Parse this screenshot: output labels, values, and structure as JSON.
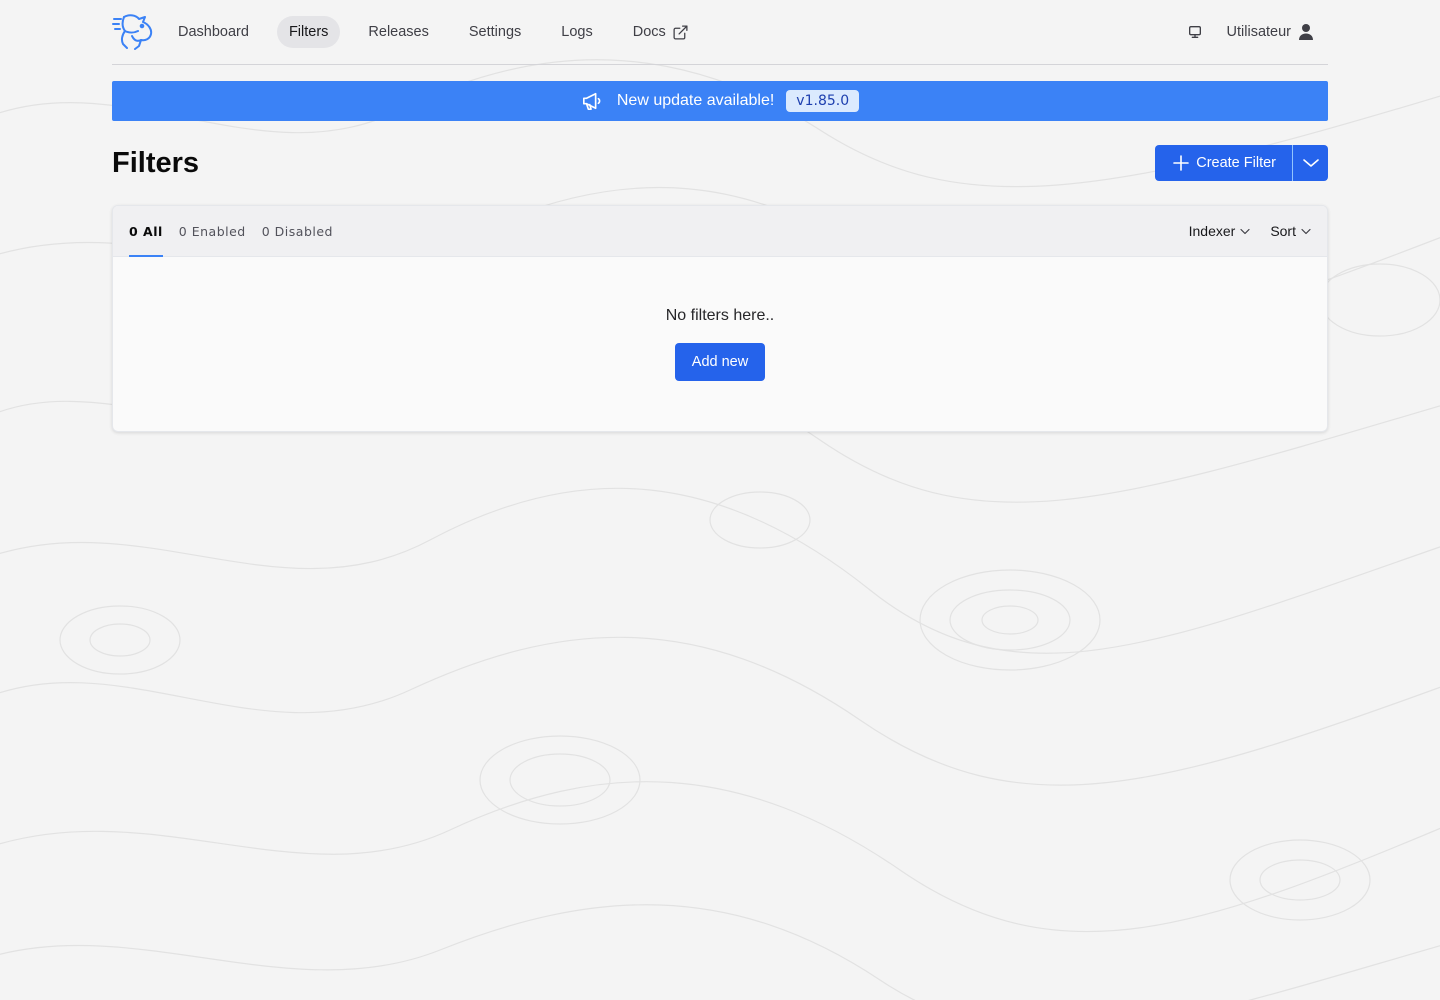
{
  "nav": {
    "items": [
      {
        "label": "Dashboard",
        "active": false
      },
      {
        "label": "Filters",
        "active": true
      },
      {
        "label": "Releases",
        "active": false
      },
      {
        "label": "Settings",
        "active": false
      },
      {
        "label": "Logs",
        "active": false
      },
      {
        "label": "Docs",
        "active": false,
        "external": true
      }
    ],
    "user_label": "Utilisateur"
  },
  "banner": {
    "text": "New update available!",
    "version": "v1.85.0"
  },
  "page": {
    "title": "Filters",
    "create_label": "Create Filter"
  },
  "card": {
    "tabs": [
      {
        "label": "0 All",
        "active": true
      },
      {
        "label": "0 Enabled",
        "active": false
      },
      {
        "label": "0 Disabled",
        "active": false
      }
    ],
    "indexer_label": "Indexer",
    "sort_label": "Sort",
    "empty_text": "No filters here..",
    "add_label": "Add new"
  },
  "colors": {
    "accent": "#2563eb",
    "banner": "#3b82f6",
    "logo": "#3b82f6"
  },
  "icons": {
    "logo": "rabbit-logo-icon",
    "external": "external-link-icon",
    "theme": "monitor-icon",
    "user": "user-icon",
    "banner": "megaphone-icon",
    "plus": "plus-icon",
    "dropdown": "chevron-down-icon"
  }
}
